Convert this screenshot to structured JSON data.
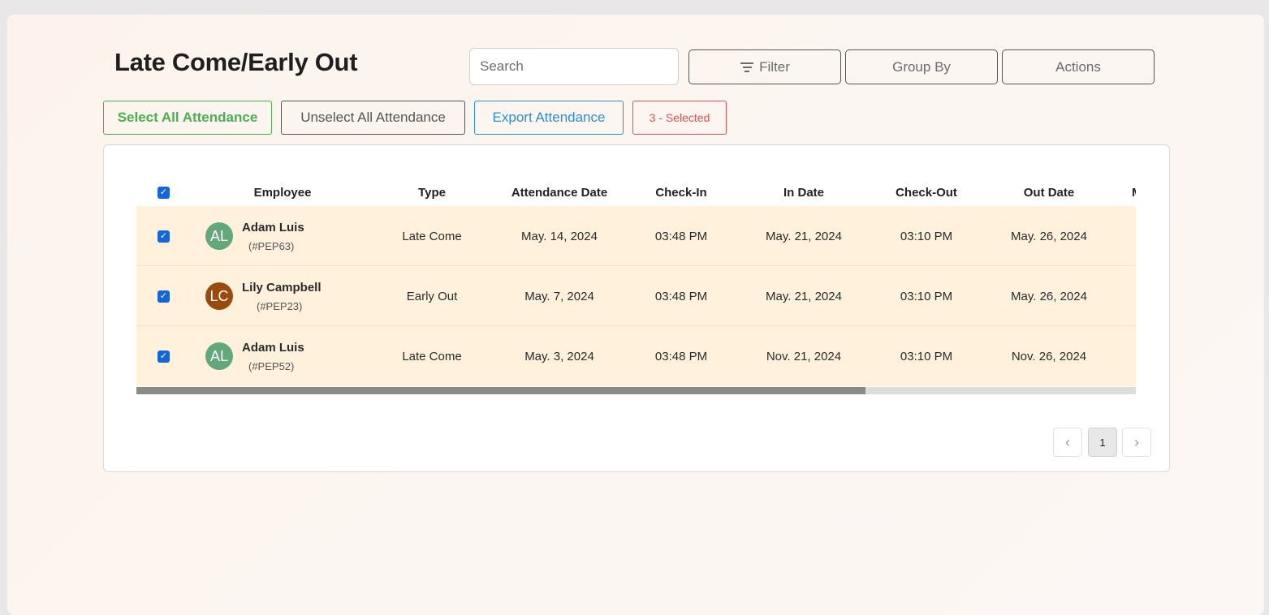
{
  "header": {
    "title": "Late Come/Early Out",
    "search_placeholder": "Search",
    "filter_label": "Filter",
    "group_by_label": "Group By",
    "actions_label": "Actions"
  },
  "selection_bar": {
    "select_all_label": "Select All Attendance",
    "unselect_all_label": "Unselect All Attendance",
    "export_label": "Export Attendance",
    "selected_count_label": "3 - Selected",
    "colors": {
      "select_all": "#4caf50",
      "unselect_all": "#555555",
      "export": "#2b8fd6",
      "selected": "#d9534f"
    }
  },
  "table": {
    "columns": [
      "Employee",
      "Type",
      "Attendance Date",
      "Check-In",
      "In Date",
      "Check-Out",
      "Out Date",
      "M"
    ],
    "rows": [
      {
        "initials": "AL",
        "avatar_color": "#63a87a",
        "name": "Adam Luis",
        "id": "(#PEP63)",
        "type": "Late Come",
        "attendance_date": "May. 14, 2024",
        "check_in": "03:48 PM",
        "in_date": "May. 21, 2024",
        "check_out": "03:10 PM",
        "out_date": "May. 26, 2024",
        "checked": true
      },
      {
        "initials": "LC",
        "avatar_color": "#9a4a0c",
        "name": "Lily Campbell",
        "id": "(#PEP23)",
        "type": "Early Out",
        "attendance_date": "May. 7, 2024",
        "check_in": "03:48 PM",
        "in_date": "May. 21, 2024",
        "check_out": "03:10 PM",
        "out_date": "May. 26, 2024",
        "checked": true
      },
      {
        "initials": "AL",
        "avatar_color": "#63a87a",
        "name": "Adam Luis",
        "id": "(#PEP52)",
        "type": "Late Come",
        "attendance_date": "May. 3, 2024",
        "check_in": "03:48 PM",
        "in_date": "Nov. 21, 2024",
        "check_out": "03:10 PM",
        "out_date": "Nov. 26, 2024",
        "checked": true
      }
    ],
    "row_highlight_color": "#fff1dc"
  },
  "pagination": {
    "prev_glyph": "‹",
    "current_page": "1",
    "next_glyph": "›"
  },
  "icons": {
    "check_glyph": "✓",
    "filter_icon": "filter-lines-icon"
  }
}
